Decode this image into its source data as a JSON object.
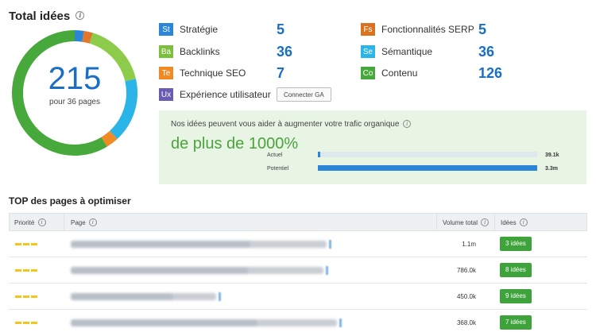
{
  "header": {
    "title": "Total idées"
  },
  "donut": {
    "total": "215",
    "subtitle": "pour 36 pages",
    "segments": [
      {
        "name": "Stratégie",
        "value": 5,
        "color": "#2b86d8"
      },
      {
        "name": "Fonctionnalités SERP",
        "value": 5,
        "color": "#e0772a"
      },
      {
        "name": "Backlinks",
        "value": 36,
        "color": "#8dcc4a"
      },
      {
        "name": "Sémantique",
        "value": 36,
        "color": "#2ab4e8"
      },
      {
        "name": "Technique SEO",
        "value": 7,
        "color": "#f08a24"
      },
      {
        "name": "Contenu",
        "value": 126,
        "color": "#47a83c"
      }
    ]
  },
  "categories": [
    {
      "abbr": "St",
      "label": "Stratégie",
      "value": "5",
      "color": "#2b86d8"
    },
    {
      "abbr": "Fs",
      "label": "Fonctionnalités SERP",
      "value": "5",
      "color": "#d9731f"
    },
    {
      "abbr": "Ba",
      "label": "Backlinks",
      "value": "36",
      "color": "#7cbf3b"
    },
    {
      "abbr": "Se",
      "label": "Sémantique",
      "value": "36",
      "color": "#2ab4e8"
    },
    {
      "abbr": "Te",
      "label": "Technique SEO",
      "value": "7",
      "color": "#f08a24"
    },
    {
      "abbr": "Co",
      "label": "Contenu",
      "value": "126",
      "color": "#47a83c"
    },
    {
      "abbr": "Ux",
      "label": "Expérience utilisateur",
      "color": "#6a5bb5"
    }
  ],
  "connect_ga": "Connecter GA",
  "growth": {
    "text": "Nos idées peuvent vous aider à augmenter votre trafic organique",
    "big": "de plus de 1000%",
    "actuel_label": "Actuel",
    "actuel_value": "39.1k",
    "actuel_fraction": 0.012,
    "potentiel_label": "Potentiel",
    "potentiel_value": "3.3m",
    "potentiel_fraction": 1.0
  },
  "top_title": "TOP des pages à optimiser",
  "table": {
    "headers": {
      "priority": "Priorité",
      "page": "Page",
      "volume": "Volume total",
      "ideas": "Idées"
    },
    "rows": [
      {
        "volume": "1.1m",
        "ideas": "3 idées"
      },
      {
        "volume": "786.0k",
        "ideas": "8 idées"
      },
      {
        "volume": "450.0k",
        "ideas": "9 idées"
      },
      {
        "volume": "368.0k",
        "ideas": "7 idées"
      }
    ]
  }
}
